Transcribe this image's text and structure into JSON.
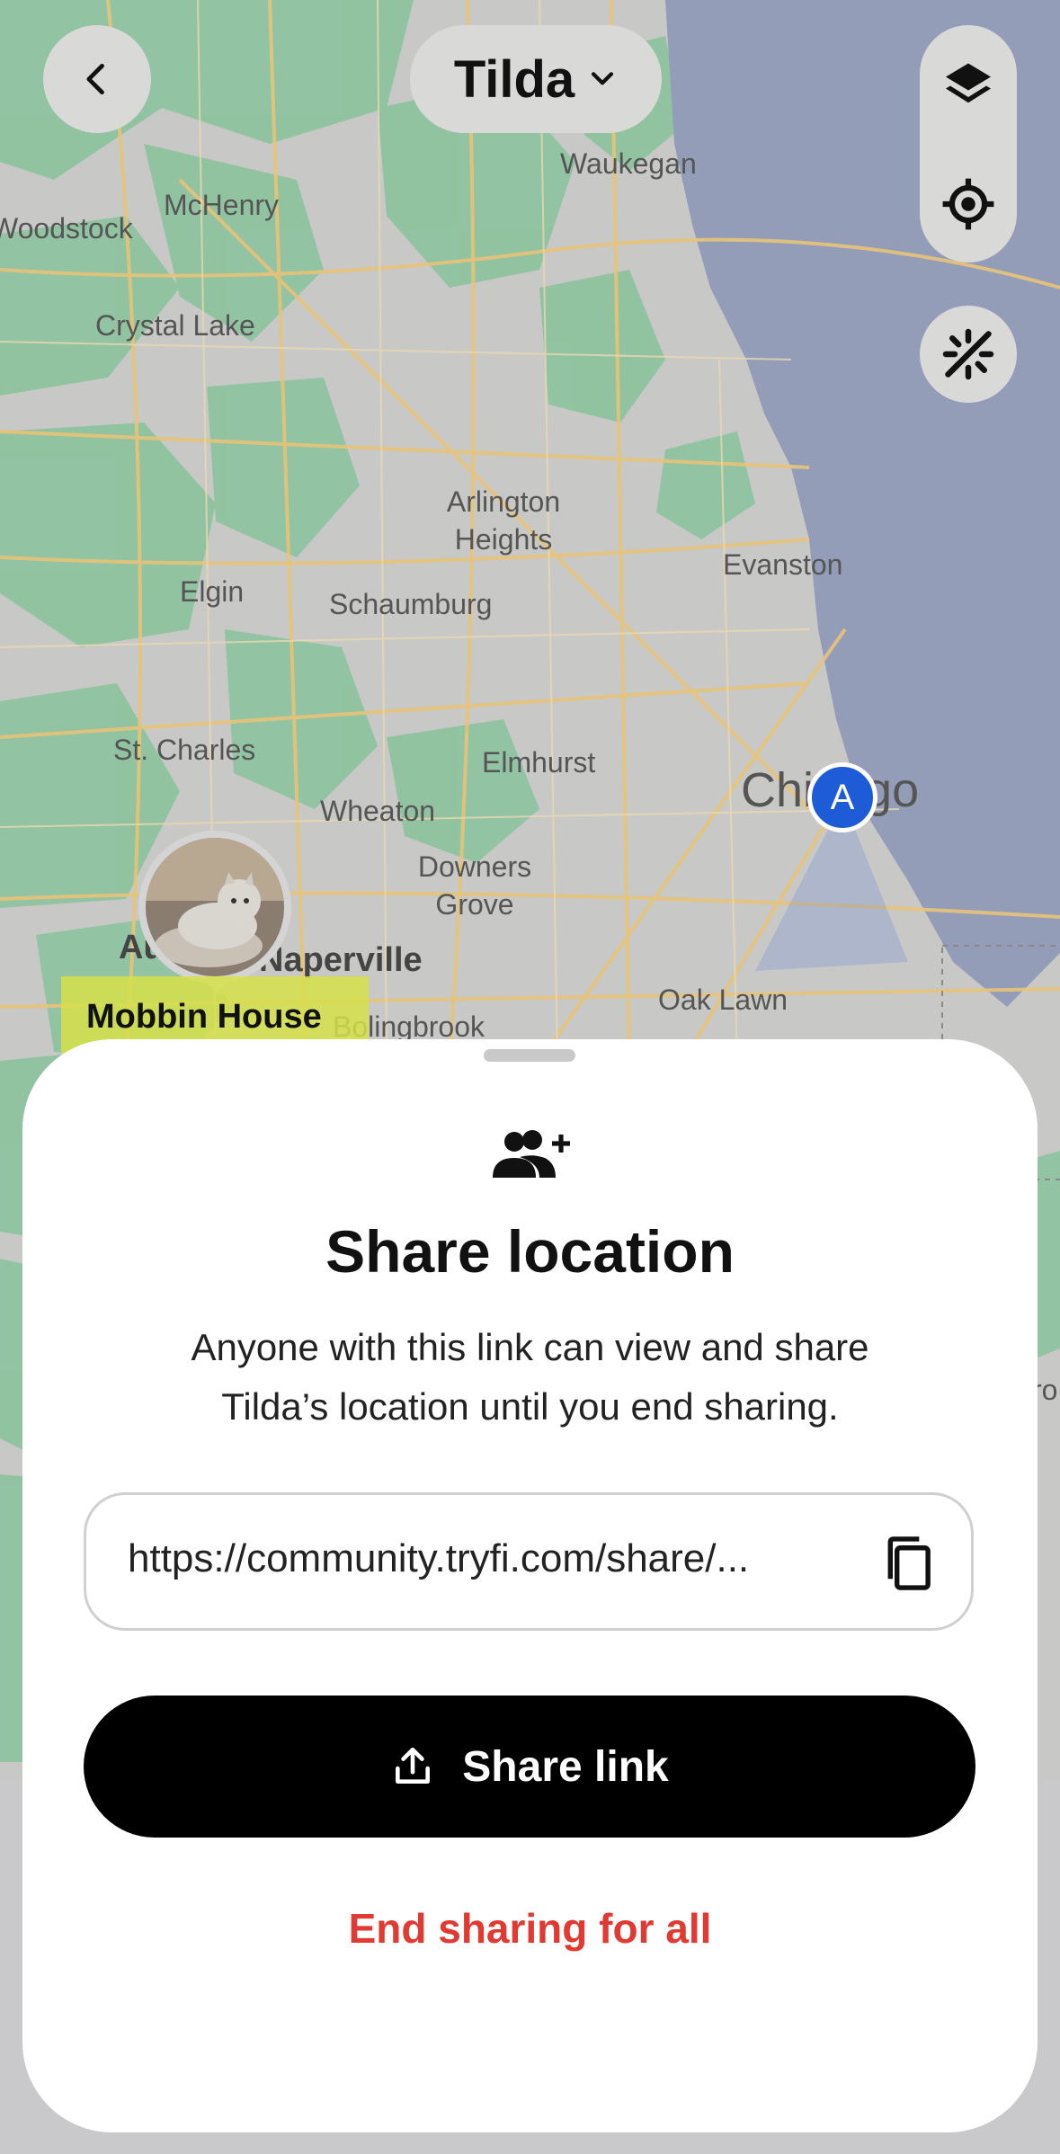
{
  "header": {
    "pet_name": "Tilda"
  },
  "map": {
    "labels": [
      {
        "text": "Waukegan"
      },
      {
        "text": "McHenry"
      },
      {
        "text": "Woodstock"
      },
      {
        "text": "Crystal Lake"
      },
      {
        "text": "Arlington Heights"
      },
      {
        "text": "Evanston"
      },
      {
        "text": "Elgin"
      },
      {
        "text": "Schaumburg"
      },
      {
        "text": "St. Charles"
      },
      {
        "text": "Elmhurst"
      },
      {
        "text": "Wheaton"
      },
      {
        "text": "Downers Grove"
      },
      {
        "text": "Chicago"
      },
      {
        "text": "Naperville"
      },
      {
        "text": "Oak Lawn"
      },
      {
        "text": "Bolingbrook"
      }
    ],
    "aurora_fragment": "Au",
    "place_name": "Mobbin House",
    "marker_letter": "A",
    "right_fragment": "ro"
  },
  "sheet": {
    "title": "Share location",
    "description_line1": "Anyone with this link can view and share",
    "description_line2": "Tilda’s location until you end sharing.",
    "link": "https://community.tryfi.com/share/...",
    "share_button": "Share link",
    "end_sharing": "End sharing for all"
  },
  "colors": {
    "map_land": "#c8c8c6",
    "map_green": "#8fc3a0",
    "map_water": "#949db8",
    "roads": "#e8c47a",
    "marker_blue": "#1e5bd6",
    "end_sharing_red": "#e03a32",
    "place_highlight": "#d7e04a"
  }
}
